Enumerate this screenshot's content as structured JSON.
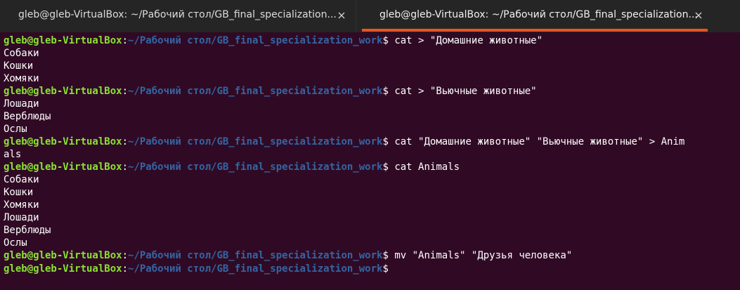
{
  "tabs": [
    {
      "title": "gleb@gleb-VirtualBox: ~/Рабочий стол/GB_final_specialization...",
      "close_icon": "close-icon"
    },
    {
      "title": "gleb@gleb-VirtualBox: ~/Рабочий стол/GB_final_specialization...",
      "close_icon": "close-icon"
    }
  ],
  "colors": {
    "background": "#300a24",
    "tabbar": "#252525",
    "active_tab_indicator": "#e95420",
    "prompt_user": "#8ae234",
    "prompt_path": "#3465a4",
    "output_text": "#ffffff"
  },
  "prompt": {
    "user": "gleb@gleb-VirtualBox",
    "colon": ":",
    "path": "~/Рабочий стол/GB_final_specialization_work",
    "symbol": "$"
  },
  "terminal": {
    "lines": [
      {
        "type": "prompt",
        "command": " cat > \"Домашние животные\""
      },
      {
        "type": "output",
        "text": "Собаки"
      },
      {
        "type": "output",
        "text": "Кошки"
      },
      {
        "type": "output",
        "text": "Хомяки"
      },
      {
        "type": "prompt",
        "command": " cat > \"Вьючные животные\""
      },
      {
        "type": "output",
        "text": "Лошади"
      },
      {
        "type": "output",
        "text": "Верблюды"
      },
      {
        "type": "output",
        "text": "Ослы"
      },
      {
        "type": "prompt",
        "command": " cat \"Домашние животные\" \"Вьючные животные\" > Anim"
      },
      {
        "type": "output",
        "text": "als"
      },
      {
        "type": "prompt",
        "command": " cat Animals"
      },
      {
        "type": "output",
        "text": "Собаки"
      },
      {
        "type": "output",
        "text": "Кошки"
      },
      {
        "type": "output",
        "text": "Хомяки"
      },
      {
        "type": "output",
        "text": "Лошади"
      },
      {
        "type": "output",
        "text": "Верблюды"
      },
      {
        "type": "output",
        "text": "Ослы"
      },
      {
        "type": "prompt",
        "command": " mv \"Animals\" \"Друзья человека\""
      },
      {
        "type": "prompt",
        "command": ""
      }
    ]
  }
}
